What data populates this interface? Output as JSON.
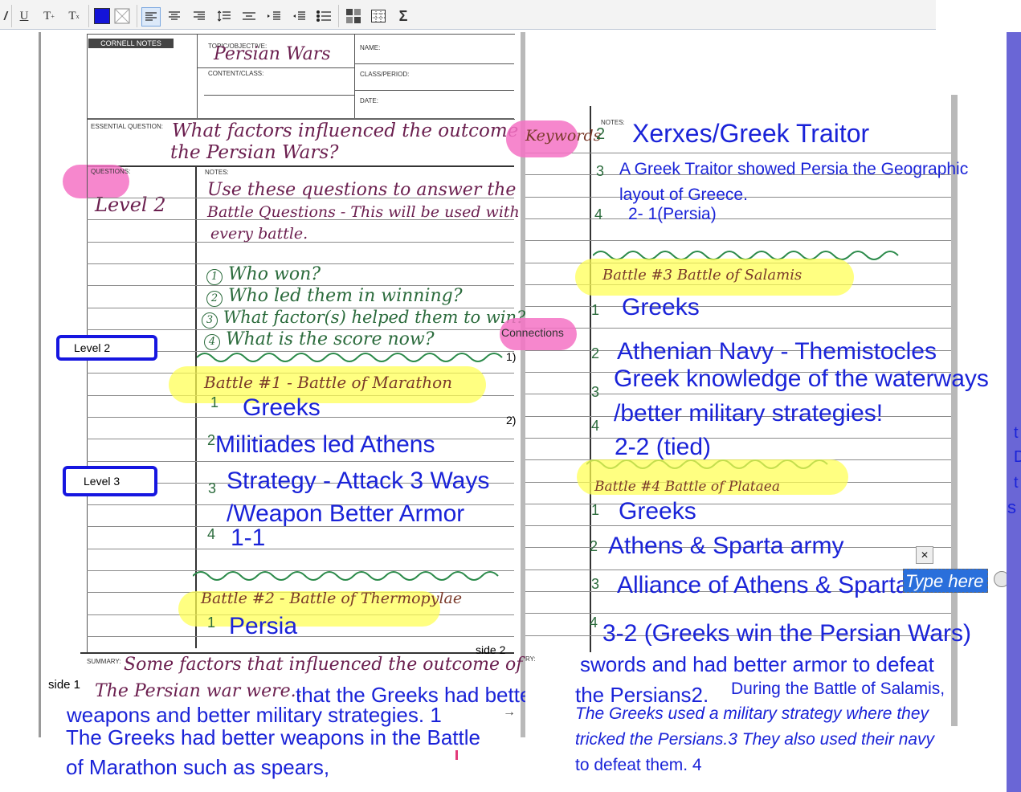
{
  "toolbar": {
    "underline": "U",
    "superscript": "T",
    "subscript": "T",
    "sigma": "Σ",
    "color_primary": "#1414d8",
    "icons": [
      "bold-icon",
      "underline-icon",
      "superscript-icon",
      "subscript-icon",
      "text-color-icon",
      "background-color-icon",
      "align-left-icon",
      "align-center-icon",
      "align-right-icon",
      "line-spacing-icon",
      "justify-icon",
      "indent-icon",
      "outdent-icon",
      "bulleted-list-icon",
      "layout-icon",
      "table-icon",
      "sigma-icon"
    ]
  },
  "left_page": {
    "header_label": "CORNELL NOTES",
    "topic_label": "TOPIC/OBJECTIVE:",
    "topic_value": "Persian Wars",
    "name_label": "NAME:",
    "content_label": "CONTENT/CLASS:",
    "class_label": "CLASS/PERIOD:",
    "date_label": "DATE:",
    "eq_label": "ESSENTIAL QUESTION:",
    "eq_line1": "What factors influenced the outcome of",
    "eq_line2": "the Persian Wars?",
    "questions_label": "QUESTIONS:",
    "notes_label": "NOTES:",
    "level2_hw": "Level 2",
    "notes_intro": [
      "Use these questions to answer the",
      "Battle Questions - This will be used with",
      "every battle."
    ],
    "questions": [
      "Who won?",
      "Who led them in winning?",
      "What factor(s) helped them to win?",
      "What is the score now?"
    ],
    "question_nums": [
      "1",
      "2",
      "3",
      "4"
    ],
    "battle1": "Battle #1 - Battle of Marathon",
    "battle2": "Battle #2 - Battle of Thermopylae",
    "summary_label": "SUMMARY:",
    "summary_hw1": "Some factors that influenced the outcome of",
    "summary_hw2": "The Persian war were..",
    "side_label": "side 1",
    "page_mark": "→"
  },
  "left_typed": {
    "b1_n1": "1",
    "b1_a1": "Greeks",
    "b1_n2": "2",
    "b1_a2": "Militiades led Athens",
    "b1_n3": "3",
    "b1_a3a": "Strategy - Attack 3 Ways",
    "b1_a3b": "/Weapon Better Armor",
    "b1_n4": "4",
    "b1_a4": "1-1",
    "b2_n1": "1",
    "b2_a1": "Persia"
  },
  "level_boxes": [
    "Level 2",
    "Level 3"
  ],
  "right_page": {
    "keywords_hl": "Keywords",
    "notes_label": "NOTES:",
    "connections_label": "Connections",
    "conn_1": "1)",
    "conn_2": "2)",
    "summary_label": "RY:",
    "side_label": "side 2",
    "battle3": "Battle #3 Battle of Salamis",
    "battle4": "Battle #4 Battle of Plataea"
  },
  "right_typed": {
    "n2": "2",
    "a2": "Xerxes/Greek Traitor",
    "n3": "3",
    "a3a": "A Greek Traitor showed Persia the Geographic",
    "a3b": "layout of Greece.",
    "n4": "4",
    "a4": "2- 1(Persia)",
    "b3_n1": "1",
    "b3_a1": "Greeks",
    "b3_n2": "2",
    "b3_a2": "Athenian Navy - Themistocles",
    "b3_n3": "3",
    "b3_a3a": "Greek knowledge of the waterways",
    "b3_a3b": "/better military strategies!",
    "b3_n4": "4",
    "b3_a4": "2-2 (tied)",
    "b4_n1": "1",
    "b4_a1": "Greeks",
    "b4_n2": "2",
    "b4_a2": "Athens & Sparta army",
    "b4_n3": "3",
    "b4_a3": "Alliance of Athens & Sparta",
    "b4_n4": "4",
    "b4_a4": "3-2 (Greeks win the Persian Wars)"
  },
  "summary_typed": {
    "left_line1": "that the Greeks had better",
    "left_line2": "weapons and better military strategies. 1",
    "left_line3": "The Greeks had better weapons in the Battle",
    "left_line4": "of Marathon such as spears,",
    "right_line1": "swords and had better armor to defeat",
    "right_line2a": "the Persians2.",
    "right_line2b": "During the Battle of Salamis,",
    "right_line3": "The Greeks used a military strategy where they",
    "right_line4": "tricked the Persians.3 They also used their navy",
    "right_line5": "to defeat them. 4"
  },
  "editor": {
    "text_input_placeholder": "Type here",
    "close_glyph": "✕"
  },
  "right_edge_letters": [
    "t",
    "D",
    "t",
    "s"
  ]
}
